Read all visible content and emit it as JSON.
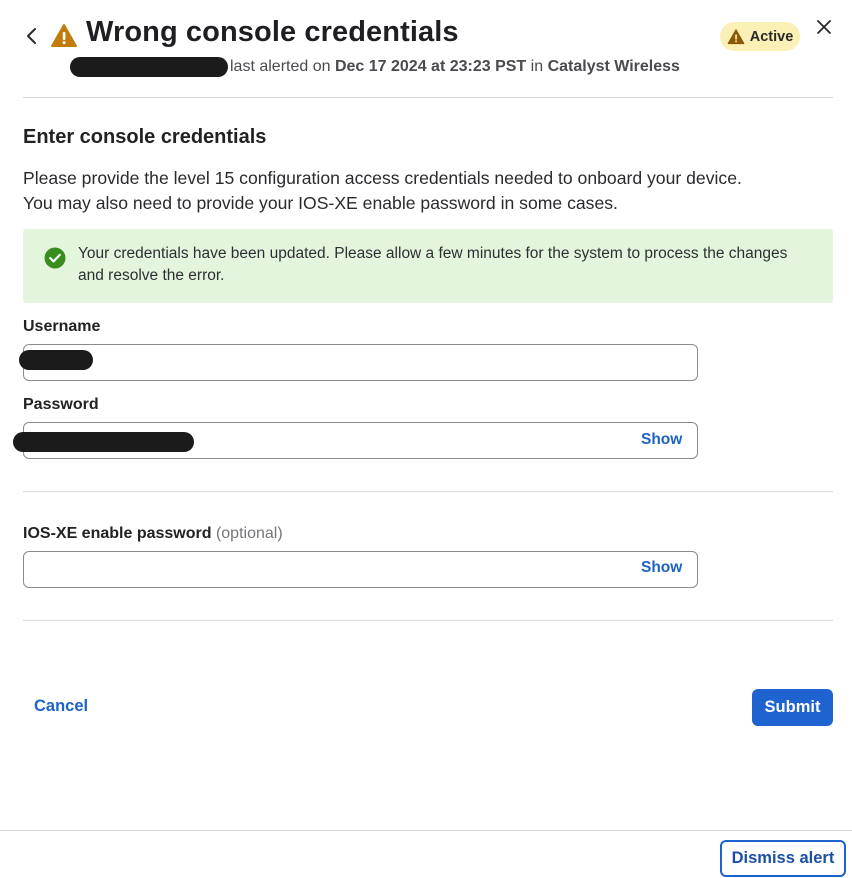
{
  "header": {
    "title": "Wrong console credentials",
    "status_badge": "Active",
    "subline_prefix": "last alerted on",
    "alert_time": "Dec 17 2024 at 23:23 PST",
    "in_word": "in",
    "network": "Catalyst Wireless"
  },
  "section": {
    "title": "Enter console credentials",
    "description_line1": "Please provide the level 15 configuration access credentials needed to onboard your device.",
    "description_line2": "You may also need to provide your IOS-XE enable password in some cases."
  },
  "success_banner": {
    "message": "Your credentials have been updated. Please allow a few minutes for the system to process the changes and resolve the error."
  },
  "form": {
    "username_label": "Username",
    "password_label": "Password",
    "password_show": "Show",
    "enable_password_label": "IOS-XE enable password",
    "enable_password_optional": "(optional)",
    "enable_password_show": "Show"
  },
  "actions": {
    "cancel": "Cancel",
    "submit": "Submit",
    "dismiss": "Dismiss alert"
  },
  "colors": {
    "accent": "#1f63d0",
    "warning": "#c27c0e",
    "success_bg": "#e3f5dc",
    "success_icon": "#3a8e1e",
    "badge_bg": "#fbf0b5"
  },
  "icons": [
    "back-chevron-icon",
    "warning-icon",
    "close-icon",
    "check-circle-icon"
  ]
}
